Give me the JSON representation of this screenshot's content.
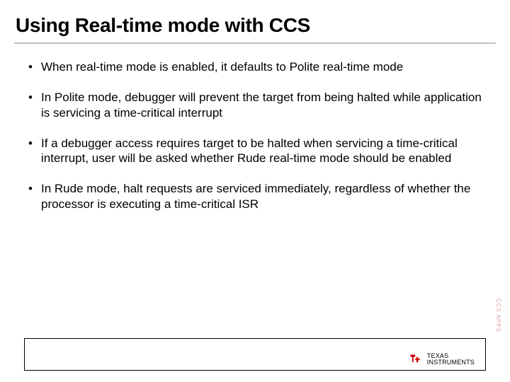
{
  "title": "Using Real-time mode with CCS",
  "bullets": [
    "When real-time mode is enabled, it defaults to Polite real-time mode",
    "In Polite mode, debugger will prevent the target from being halted while application is servicing a time-critical interrupt",
    "If a debugger access requires target to be halted when servicing a time-critical interrupt, user will be asked whether Rude real-time mode should be enabled",
    "In Rude mode, halt requests are serviced immediately, regardless of whether the processor is executing a time-critical ISR"
  ],
  "footer": {
    "brand_line1": "TEXAS",
    "brand_line2": "INSTRUMENTS"
  },
  "side_label": "CCS APPS"
}
